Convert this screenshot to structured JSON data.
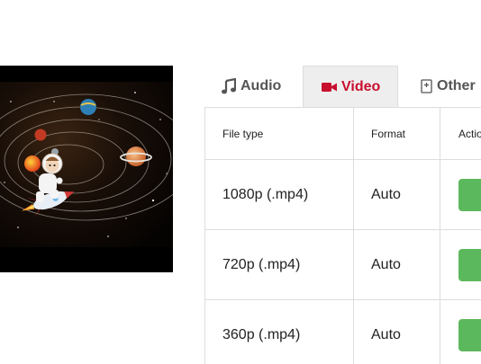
{
  "tabs": [
    {
      "label": "Audio",
      "icon": "music-note-icon",
      "active": false
    },
    {
      "label": "Video",
      "icon": "video-camera-icon",
      "active": true
    },
    {
      "label": "Other",
      "icon": "file-icon",
      "active": false
    }
  ],
  "table": {
    "headers": [
      "File type",
      "Format",
      "Action"
    ],
    "rows": [
      {
        "file_type": "1080p (.mp4)",
        "format": "Auto"
      },
      {
        "file_type": "720p (.mp4)",
        "format": "Auto"
      },
      {
        "file_type": "360p (.mp4)",
        "format": "Auto"
      }
    ]
  },
  "colors": {
    "active_tab_text": "#c8102e",
    "download_button": "#5cb85c"
  }
}
